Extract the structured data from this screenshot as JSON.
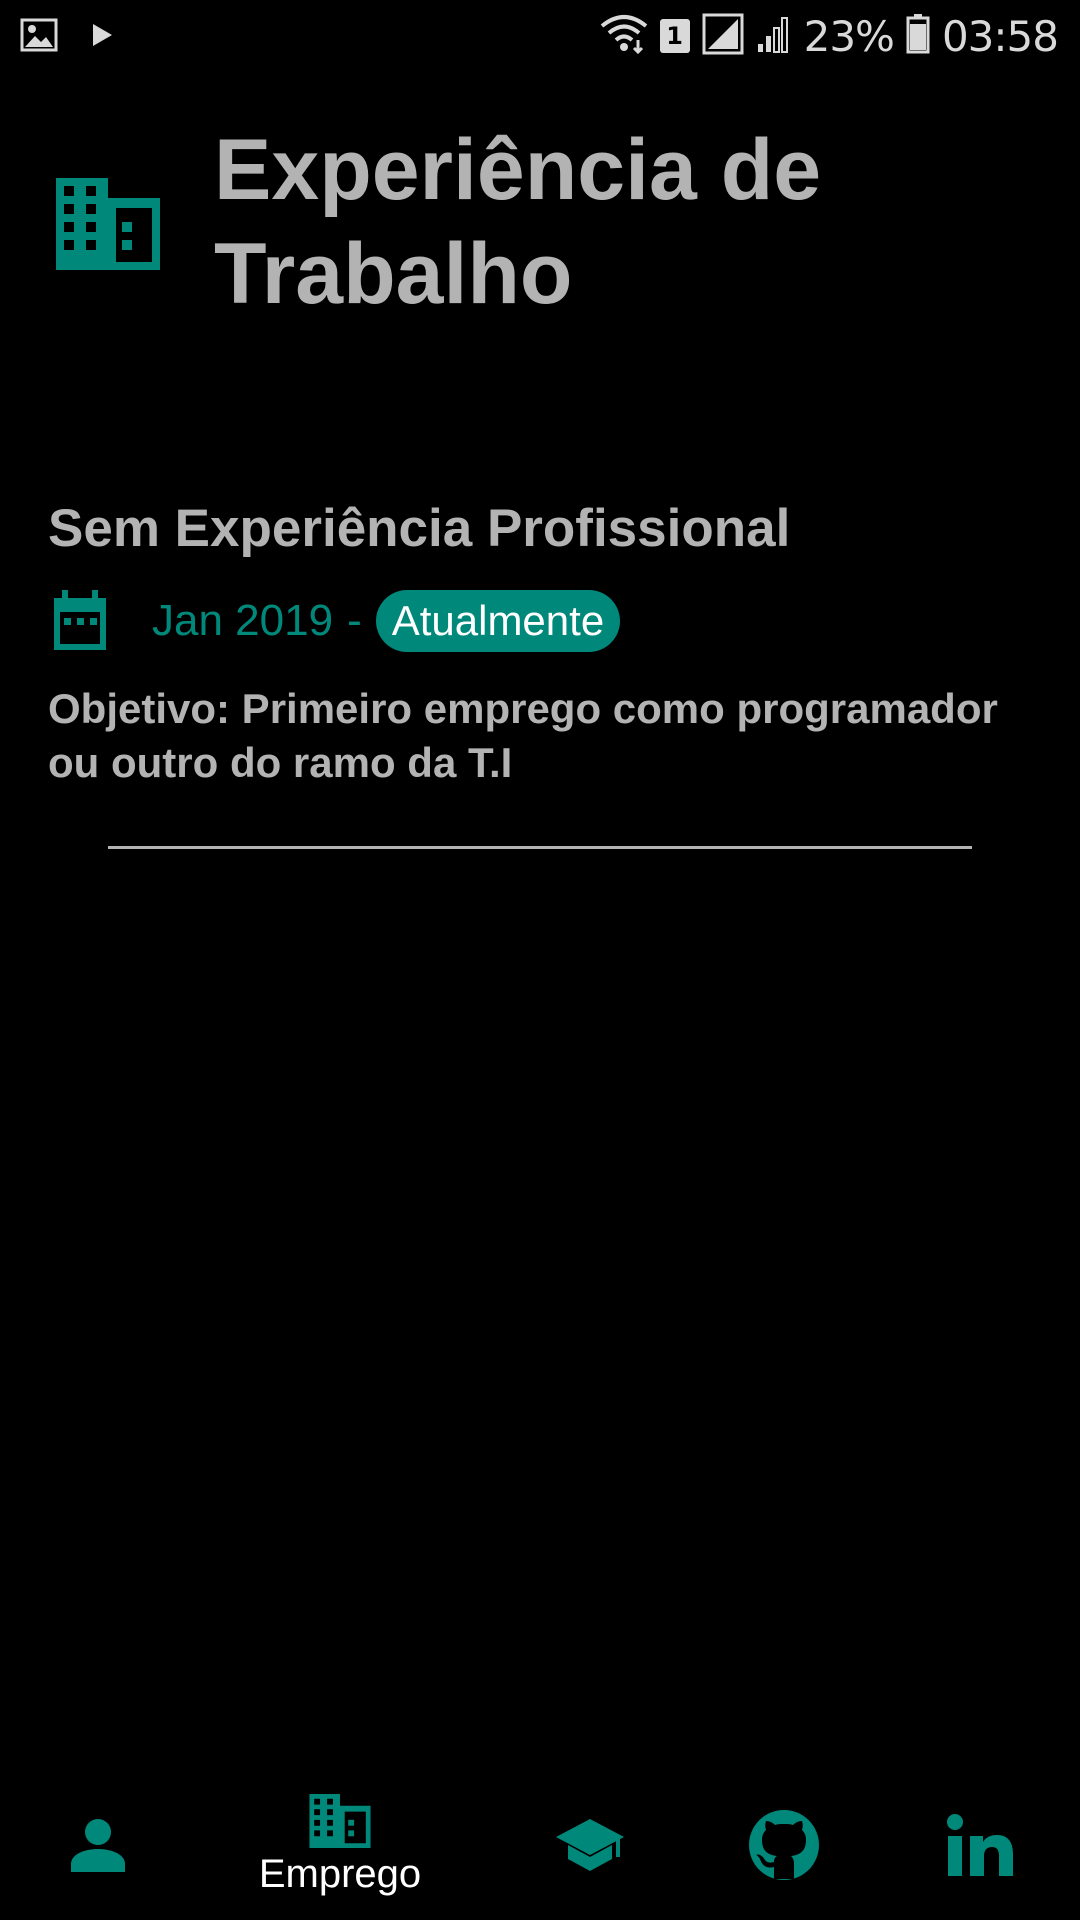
{
  "status_bar": {
    "battery": "23%",
    "time": "03:58",
    "sim": "1",
    "icons": [
      "image-icon",
      "play-icon",
      "wifi-icon",
      "sim-icon",
      "signal-icon",
      "signal-weak-icon",
      "battery-icon"
    ]
  },
  "header": {
    "title": "Experiência de Trabalho",
    "icon": "building-icon"
  },
  "experience": {
    "title": "Sem Experiência Profissional",
    "date_start": "Jan 2019",
    "date_separator": "-",
    "date_end": "Atualmente",
    "objective": "Objetivo: Primeiro emprego como programador ou outro do ramo da T.I"
  },
  "bottom_nav": {
    "items": [
      {
        "icon": "person-icon",
        "label": ""
      },
      {
        "icon": "building-icon",
        "label": "Emprego",
        "active": true
      },
      {
        "icon": "graduation-cap-icon",
        "label": ""
      },
      {
        "icon": "github-icon",
        "label": ""
      },
      {
        "icon": "linkedin-icon",
        "label": ""
      }
    ]
  },
  "colors": {
    "accent": "#00897b",
    "text": "#b3b3b3",
    "background": "#000000",
    "active_label": "#ffffff"
  }
}
